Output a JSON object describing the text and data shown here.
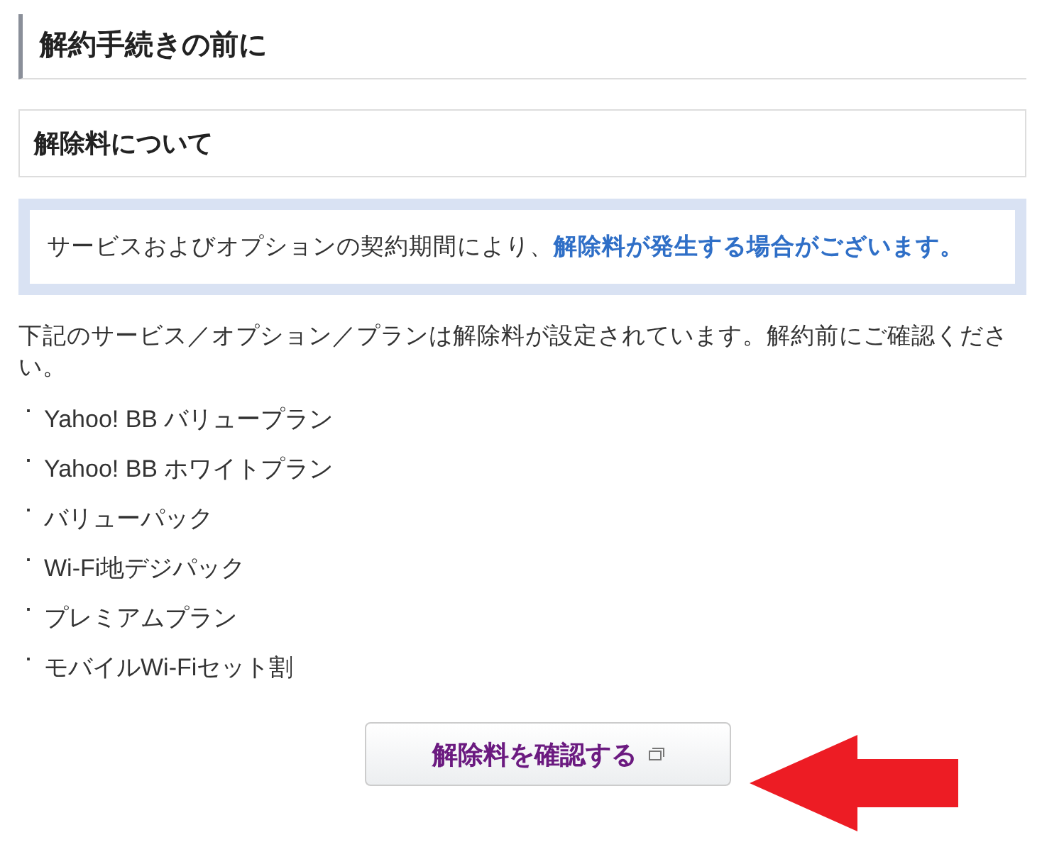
{
  "heading": "解約手続きの前に",
  "subheading": "解除料について",
  "notice": "サービスおよびオプションの契約期間により、**解除料が発生する場合がございます。**",
  "intro": "下記のサービス／オプション／プランは解除料が設定されています。解約前にご確認ください。",
  "items": [
    {
      "marker": "･",
      "text": "Yahoo! BB バリュープラン"
    },
    {
      "marker": "･",
      "text": "Yahoo! BB ホワイトプラン"
    },
    {
      "marker": "･",
      "text": "バリューパック"
    },
    {
      "marker": "･",
      "text": "Wi-Fi地デジパック"
    },
    {
      "marker": "･",
      "text": "プレミアムプラン"
    },
    {
      "marker": "･",
      "text": "モバイルWi-Fiセット割"
    }
  ],
  "button": {
    "label": "解除料を確認する",
    "opens_new_window": true
  }
}
